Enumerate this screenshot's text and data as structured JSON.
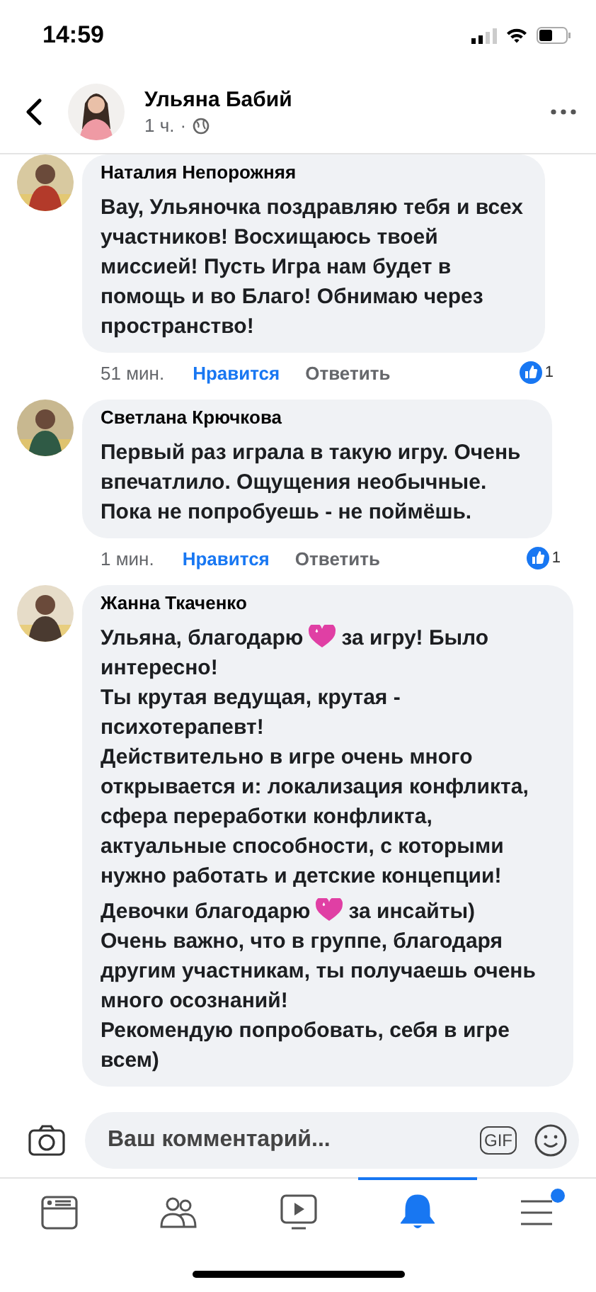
{
  "status_bar": {
    "time": "14:59"
  },
  "header": {
    "name": "Ульяна Бабий",
    "time": "1 ч.",
    "separator": "·"
  },
  "comments": [
    {
      "author": "Наталия Непорожняя",
      "avatar": {
        "kind": "picture"
      },
      "paragraphs": [
        [
          {
            "kind": "text",
            "text": "Вау, Ульяночка поздравляю тебя и всех участников! Восхищаюсь твоей миссией! Пусть Игра нам будет  в помощь и во Благо! Обнимаю через пространство!"
          }
        ]
      ],
      "time": "51 мин.",
      "like": "Нравится",
      "liked": true,
      "reply": "Ответить",
      "reactions": "1"
    },
    {
      "author": "Светлана Крючкова",
      "avatar": {
        "kind": "picture"
      },
      "paragraphs": [
        [
          {
            "kind": "text",
            "text": "Первый раз играла в такую игру. Очень впечатлило. Ощущения необычные. Пока не попробуешь - не поймёшь."
          }
        ]
      ],
      "time": "1 мин.",
      "like": "Нравится",
      "liked": true,
      "reply": "Ответить",
      "reactions": "1"
    },
    {
      "author": "Жанна Ткаченко",
      "avatar": {
        "kind": "picture"
      },
      "paragraphs": [
        [
          {
            "kind": "text",
            "text": "Ульяна, благодарю"
          },
          {
            "kind": "heart"
          },
          {
            "kind": "text",
            "text": "за игру! Было"
          },
          {
            "kind": "text",
            "text": "интересно!"
          },
          {
            "kind": "break"
          },
          {
            "kind": "text",
            "text": "Ты крутая ведущая, крутая - психотерапевт!"
          },
          {
            "kind": "break"
          },
          {
            "kind": "text",
            "text": "Действительно в игре очень много открывается и: локализация конфликта, сфера переработки конфликта, актуальные способности, с которыми нужно работать и детские концепции!"
          }
        ],
        [
          {
            "kind": "text",
            "text": "Девочки благодарю"
          },
          {
            "kind": "heart"
          },
          {
            "kind": "text",
            "text": "за инсайты)"
          },
          {
            "kind": "break"
          },
          {
            "kind": "text",
            "text": "Очень важно, что в группе, благодаря другим участникам, ты получаешь очень много осознаний!"
          },
          {
            "kind": "break"
          },
          {
            "kind": "text",
            "text": "Рекомендую попробовать, себя в игре всем)"
          }
        ]
      ]
    }
  ],
  "composer": {
    "placeholder": "Ваш комментарий...",
    "gif": "GIF"
  },
  "tabs": [
    {
      "kind": "feed",
      "selected": false,
      "badge": false
    },
    {
      "kind": "groups",
      "selected": false,
      "badge": false
    },
    {
      "kind": "watch",
      "selected": false,
      "badge": false
    },
    {
      "kind": "notifications",
      "selected": true,
      "badge": false
    },
    {
      "kind": "menu",
      "selected": false,
      "badge": true
    }
  ]
}
